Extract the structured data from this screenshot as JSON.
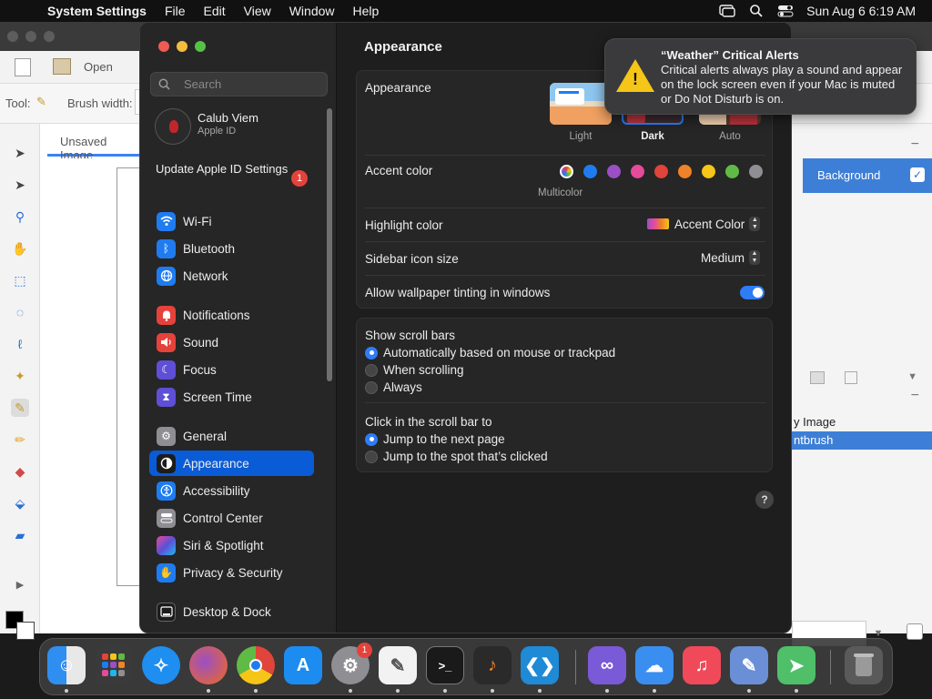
{
  "menubar": {
    "app_name": "System Settings",
    "menus": [
      "File",
      "Edit",
      "View",
      "Window",
      "Help"
    ],
    "clock": "Sun Aug 6  6:19 AM"
  },
  "background_app": {
    "open_label": "Open",
    "tool_label": "Tool:",
    "brush_width_label": "Brush width:",
    "tab_label": "Unsaved Image",
    "layer_label": "Background",
    "history_item_1": "y Image",
    "history_item_2": "ntbrush"
  },
  "sidebar": {
    "search_placeholder": "Search",
    "profile_name": "Calub Viem",
    "profile_sub": "Apple ID",
    "update_label": "Update Apple ID Settings",
    "update_badge": "1",
    "items": [
      {
        "label": "Wi-Fi",
        "icon": "wifi-icon",
        "color": "#1f7cf0"
      },
      {
        "label": "Bluetooth",
        "icon": "bluetooth-icon",
        "color": "#1f7cf0"
      },
      {
        "label": "Network",
        "icon": "globe-icon",
        "color": "#1f7cf0"
      },
      {
        "label": "Notifications",
        "icon": "bell-icon",
        "color": "#e5423b"
      },
      {
        "label": "Sound",
        "icon": "speaker-icon",
        "color": "#e5423b"
      },
      {
        "label": "Focus",
        "icon": "moon-icon",
        "color": "#5e4fd6"
      },
      {
        "label": "Screen Time",
        "icon": "hourglass-icon",
        "color": "#5e4fd6"
      },
      {
        "label": "General",
        "icon": "gear-icon",
        "color": "#8e8e93"
      },
      {
        "label": "Appearance",
        "icon": "appearance-icon",
        "color": "#1c1c1c"
      },
      {
        "label": "Accessibility",
        "icon": "accessibility-icon",
        "color": "#1f7cf0"
      },
      {
        "label": "Control Center",
        "icon": "control-center-icon",
        "color": "#8e8e93"
      },
      {
        "label": "Siri & Spotlight",
        "icon": "siri-icon",
        "color": "#b44fd6"
      },
      {
        "label": "Privacy & Security",
        "icon": "hand-icon",
        "color": "#1f7cf0"
      },
      {
        "label": "Desktop & Dock",
        "icon": "dock-icon",
        "color": "#1c1c1c"
      }
    ],
    "selected": "Appearance"
  },
  "main": {
    "title": "Appearance",
    "appearance_label": "Appearance",
    "appearance_options": [
      "Light",
      "Dark",
      "Auto"
    ],
    "appearance_selected": "Dark",
    "accent_label": "Accent color",
    "accent_selected_name": "Multicolor",
    "accent_colors": [
      "#8f8f8f",
      "#1f7cf0",
      "#9a4fc6",
      "#e64a9a",
      "#e0443a",
      "#f0822a",
      "#f5c518",
      "#5fbb46",
      "#8e8e93"
    ],
    "highlight_label": "Highlight color",
    "highlight_value": "Accent Color",
    "sidebar_icon_label": "Sidebar icon size",
    "sidebar_icon_value": "Medium",
    "tinting_label": "Allow wallpaper tinting in windows",
    "tinting_on": true,
    "scroll_bars_label": "Show scroll bars",
    "scroll_bar_options": [
      "Automatically based on mouse or trackpad",
      "When scrolling",
      "Always"
    ],
    "click_label": "Click in the scroll bar to",
    "click_options": [
      "Jump to the next page",
      "Jump to the spot that’s clicked"
    ],
    "help": "?"
  },
  "notification": {
    "title": "“Weather” Critical Alerts",
    "body": "Critical alerts always play a sound and appear on the lock screen even if your Mac is muted or Do Not Disturb is on."
  },
  "dock": {
    "badge": "1",
    "apps": [
      {
        "name": "Finder",
        "icon": "finder-icon",
        "color": "#2f8ff0"
      },
      {
        "name": "Launchpad",
        "icon": "launchpad-icon",
        "color": "#d9d9d9"
      },
      {
        "name": "Safari",
        "icon": "safari-icon",
        "color": "#1e8ef0"
      },
      {
        "name": "Firefox",
        "icon": "firefox-icon",
        "color": "#f06a1e"
      },
      {
        "name": "Chrome",
        "icon": "chrome-icon",
        "color": "#e0443a"
      },
      {
        "name": "App Store",
        "icon": "app-store-icon",
        "color": "#1c8cf0"
      },
      {
        "name": "System Settings",
        "icon": "settings-gear-icon",
        "color": "#8e8e93"
      },
      {
        "name": "TextEdit",
        "icon": "textedit-icon",
        "color": "#f2f2f2"
      },
      {
        "name": "Terminal",
        "icon": "terminal-icon",
        "color": "#1a1a1a"
      },
      {
        "name": "GarageBand",
        "icon": "guitar-icon",
        "color": "#2a2a2a"
      },
      {
        "name": "VS Code",
        "icon": "vscode-icon",
        "color": "#1f8ad6"
      },
      {
        "name": "Visual Studio",
        "icon": "visual-studio-icon",
        "color": "#7a5ad6"
      },
      {
        "name": "Weather",
        "icon": "weather-icon",
        "color": "#3a8ef0"
      },
      {
        "name": "Music",
        "icon": "music-icon",
        "color": "#f04a5a"
      },
      {
        "name": "Paintbrush",
        "icon": "paint-icon",
        "color": "#6a8fd6"
      },
      {
        "name": "Maps",
        "icon": "maps-icon",
        "color": "#4fbf6a"
      },
      {
        "name": "Trash",
        "icon": "trash-icon",
        "color": "#5a5a5a"
      }
    ]
  }
}
